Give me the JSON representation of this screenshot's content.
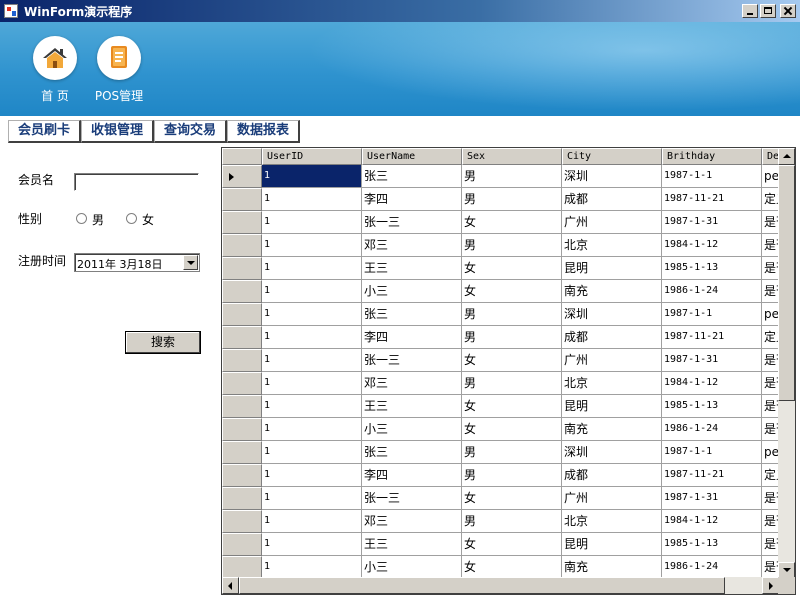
{
  "window": {
    "title": "WinForm演示程序"
  },
  "banner": {
    "buttons": [
      {
        "label": "首 页",
        "icon": "home-icon"
      },
      {
        "label": "POS管理",
        "icon": "book-icon"
      }
    ]
  },
  "tabs": [
    "会员刷卡",
    "收银管理",
    "查询交易",
    "数据报表"
  ],
  "form": {
    "member_label": "会员名",
    "member_value": "",
    "gender_label": "性别",
    "gender_options": [
      "男",
      "女"
    ],
    "regdate_label": "注册时间",
    "regdate_value": "2011年  3月18日",
    "search_label": "搜索"
  },
  "grid": {
    "columns": [
      "UserID",
      "UserName",
      "Sex",
      "City",
      "Brithday",
      "De"
    ],
    "rows": [
      [
        "1",
        "张三",
        "男",
        "深圳",
        "1987-1-1",
        "per"
      ],
      [
        "1",
        "李四",
        "男",
        "成都",
        "1987-11-21",
        "定义"
      ],
      [
        "1",
        "张一三",
        "女",
        "广州",
        "1987-1-31",
        "是否"
      ],
      [
        "1",
        "邓三",
        "男",
        "北京",
        "1984-1-12",
        "是否"
      ],
      [
        "1",
        "王三",
        "女",
        "昆明",
        "1985-1-13",
        "是否"
      ],
      [
        "1",
        "小三",
        "女",
        "南充",
        "1986-1-24",
        "是否"
      ],
      [
        "1",
        "张三",
        "男",
        "深圳",
        "1987-1-1",
        "per"
      ],
      [
        "1",
        "李四",
        "男",
        "成都",
        "1987-11-21",
        "定义"
      ],
      [
        "1",
        "张一三",
        "女",
        "广州",
        "1987-1-31",
        "是否"
      ],
      [
        "1",
        "邓三",
        "男",
        "北京",
        "1984-1-12",
        "是否"
      ],
      [
        "1",
        "王三",
        "女",
        "昆明",
        "1985-1-13",
        "是否"
      ],
      [
        "1",
        "小三",
        "女",
        "南充",
        "1986-1-24",
        "是否"
      ],
      [
        "1",
        "张三",
        "男",
        "深圳",
        "1987-1-1",
        "per"
      ],
      [
        "1",
        "李四",
        "男",
        "成都",
        "1987-11-21",
        "定义"
      ],
      [
        "1",
        "张一三",
        "女",
        "广州",
        "1987-1-31",
        "是否"
      ],
      [
        "1",
        "邓三",
        "男",
        "北京",
        "1984-1-12",
        "是否"
      ],
      [
        "1",
        "王三",
        "女",
        "昆明",
        "1985-1-13",
        "是否"
      ],
      [
        "1",
        "小三",
        "女",
        "南充",
        "1986-1-24",
        "是否"
      ]
    ]
  }
}
